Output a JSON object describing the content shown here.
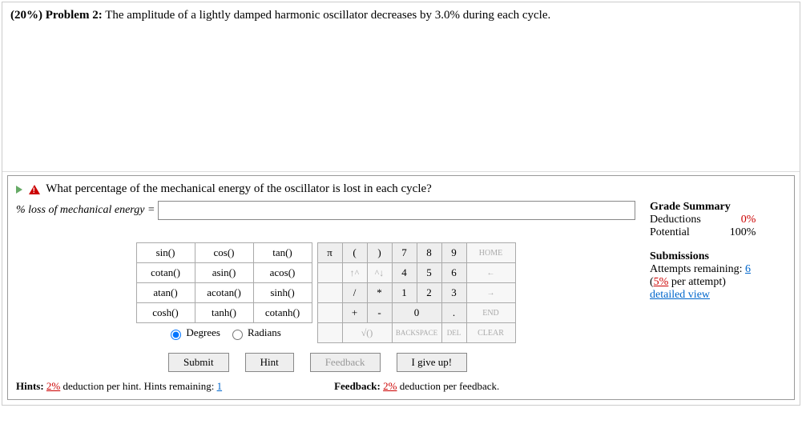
{
  "problem": {
    "weight_label": "(20%) Problem 2:",
    "text": "The amplitude of a lightly damped harmonic oscillator decreases by 3.0% during each cycle."
  },
  "part": {
    "question": "What percentage of the mechanical energy of the oscillator is lost in each cycle?",
    "answer_label": "% loss of mechanical energy =",
    "answer_value": ""
  },
  "grade": {
    "title": "Grade Summary",
    "deductions_label": "Deductions",
    "deductions_value": "0%",
    "potential_label": "Potential",
    "potential_value": "100%"
  },
  "submissions": {
    "title": "Submissions",
    "attempts_label": "Attempts remaining:",
    "attempts_value": "6",
    "penalty_label": "(5% per attempt)",
    "detailed_label": "detailed view"
  },
  "funcs": {
    "r0": [
      "sin()",
      "cos()",
      "tan()"
    ],
    "r1": [
      "cotan()",
      "asin()",
      "acos()"
    ],
    "r2": [
      "atan()",
      "acotan()",
      "sinh()"
    ],
    "r3": [
      "cosh()",
      "tanh()",
      "cotanh()"
    ]
  },
  "angle": {
    "degrees": "Degrees",
    "radians": "Radians"
  },
  "keys": {
    "pi": "π",
    "lpar": "(",
    "rpar": ")",
    "d7": "7",
    "d8": "8",
    "d9": "9",
    "home": "HOME",
    "up": "↑^",
    "upr": "^↓",
    "d4": "4",
    "d5": "5",
    "d6": "6",
    "left": "←",
    "slash": "/",
    "star": "*",
    "d1": "1",
    "d2": "2",
    "d3": "3",
    "right": "→",
    "plus": "+",
    "minus": "-",
    "d0": "0",
    "dot": ".",
    "end": "END",
    "sqrt": "√()",
    "back": "BACKSPACE",
    "del": "DEL",
    "clear": "CLEAR"
  },
  "actions": {
    "submit": "Submit",
    "hint": "Hint",
    "feedback": "Feedback",
    "giveup": "I give up!"
  },
  "hints": {
    "label": "Hints:",
    "ded": "2%",
    "text": "deduction per hint. Hints remaining:",
    "remaining": "1"
  },
  "feedback_note": {
    "label": "Feedback:",
    "ded": "2%",
    "text": "deduction per feedback."
  }
}
